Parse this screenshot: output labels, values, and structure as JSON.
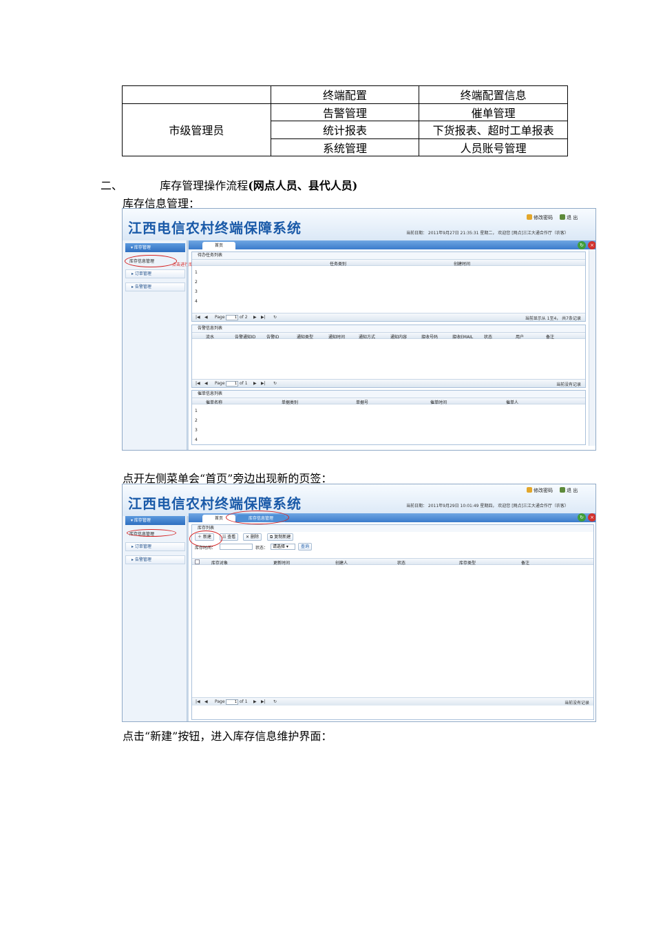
{
  "role_table": {
    "rows": [
      {
        "role": "",
        "module": "终端配置",
        "function": "终端配置信息"
      },
      {
        "role": "市级管理员",
        "module": "告警管理",
        "function": "催单管理"
      },
      {
        "role": "",
        "module": "统计报表",
        "function": "下货报表、超时工单报表"
      },
      {
        "role": "",
        "module": "系统管理",
        "function": "人员账号管理"
      }
    ]
  },
  "section": {
    "number": "二、",
    "title_plain": "库存管理操作流程",
    "title_bold": "(网点人员、县代人员)"
  },
  "paragraphs": {
    "p1": "库存信息管理：",
    "p2": "点开左侧菜单会“首页”旁边出现新的页签：",
    "p3": "点击“新建”按钮，进入库存信息维护界面："
  },
  "screenshot1": {
    "app_title": "江西电信农村终端保障系统",
    "change_password": "修改密码",
    "logout": "退 出",
    "status_line": "当前日期： 2011年9月27日 21:35:31 星期二， 欢迎您 [网点]三江大通合作厅（农客）",
    "sidebar_header": "库存管理",
    "sidebar_sub": "库存信息管理",
    "sidebar_items": [
      "订单管理",
      "告警管理"
    ],
    "tab_home": "首页",
    "annotation": "点击进行库存信息维护",
    "task_list": {
      "title": "待办任务列表",
      "cols": [
        "任务类别",
        "创建时间"
      ],
      "rows": [
        "1",
        "2",
        "3",
        "4"
      ],
      "pager_page": "Page",
      "pager_val": "1",
      "pager_of": "of 2",
      "pager_info": "当前显示从 1至4， 共7条记录"
    },
    "alarm_list": {
      "title": "告警信息列表",
      "cols": [
        "流水",
        "告警通知ID",
        "告警ID",
        "通知类型",
        "通知时间",
        "通知方式",
        "通知内容",
        "接收号码",
        "接收EMAIL",
        "状态",
        "用户",
        "备注"
      ],
      "pager_page": "Page",
      "pager_val": "1",
      "pager_of": "of 1",
      "pager_info": "当前没有记录"
    },
    "urge_list": {
      "title": "催单信息列表",
      "cols": [
        "催单名称",
        "单据类别",
        "单据号",
        "催单时间",
        "催单人"
      ],
      "rows": [
        "1",
        "2",
        "3",
        "4"
      ]
    }
  },
  "screenshot2": {
    "app_title": "江西电信农村终端保障系统",
    "change_password": "修改密码",
    "logout": "退 出",
    "status_line": "当前日期： 2011年9月29日 10:01:49 星期四， 欢迎您 [网点]三江大通合作厅（农客）",
    "sidebar_header": "库存管理",
    "sidebar_sub": "库存信息管理",
    "sidebar_items": [
      "订单管理",
      "告警管理"
    ],
    "tab_home": "首页",
    "tab_active": "库存信息管理",
    "panel_title": "库存列表",
    "buttons": [
      "新建",
      "查看",
      "删除",
      "复制新建"
    ],
    "filter_time_label": "库存时间：",
    "filter_status_label": "状态：",
    "filter_status_value": "请选择",
    "query_button": "查询",
    "cols": [
      "库存对象",
      "更新时间",
      "创建人",
      "状态",
      "库存类型",
      "备注"
    ],
    "pager_page": "Page",
    "pager_val": "1",
    "pager_of": "of 1",
    "pager_info": "当前没有记录"
  }
}
